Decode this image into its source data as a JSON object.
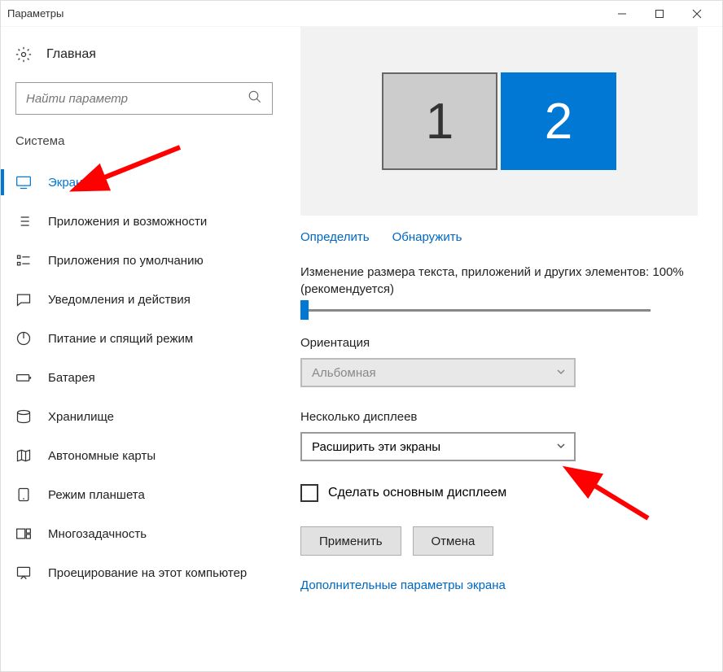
{
  "titlebar": {
    "title": "Параметры"
  },
  "sidebar": {
    "home": "Главная",
    "search_placeholder": "Найти параметр",
    "section": "Система",
    "items": [
      {
        "label": "Экран"
      },
      {
        "label": "Приложения и возможности"
      },
      {
        "label": "Приложения по умолчанию"
      },
      {
        "label": "Уведомления и действия"
      },
      {
        "label": "Питание и спящий режим"
      },
      {
        "label": "Батарея"
      },
      {
        "label": "Хранилище"
      },
      {
        "label": "Автономные карты"
      },
      {
        "label": "Режим планшета"
      },
      {
        "label": "Многозадачность"
      },
      {
        "label": "Проецирование на этот компьютер"
      }
    ]
  },
  "content": {
    "monitor1": "1",
    "monitor2": "2",
    "identify": "Определить",
    "detect": "Обнаружить",
    "scale_text": "Изменение размера текста, приложений и других элементов: 100% (рекомендуется)",
    "orientation_label": "Ориентация",
    "orientation_value": "Альбомная",
    "multi_display_label": "Несколько дисплеев",
    "multi_display_value": "Расширить эти экраны",
    "make_primary": "Сделать основным дисплеем",
    "apply": "Применить",
    "cancel": "Отмена",
    "advanced": "Дополнительные параметры экрана"
  }
}
